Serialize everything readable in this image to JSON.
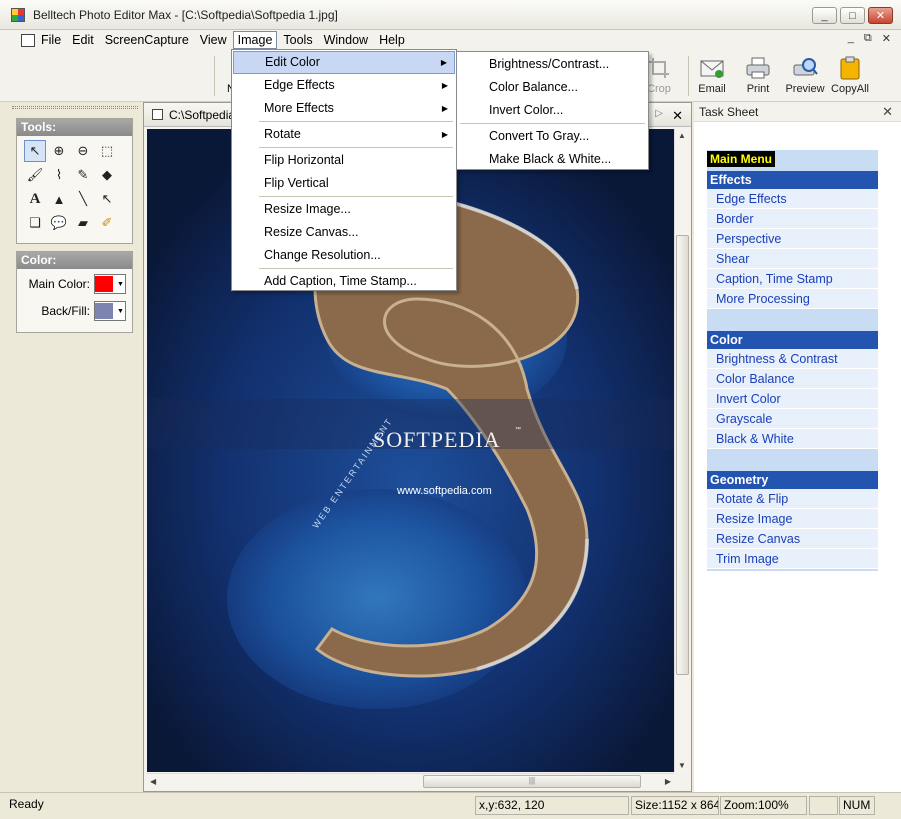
{
  "window": {
    "title": "Belltech Photo Editor Max - [C:\\Softpedia\\Softpedia 1.jpg]",
    "controls": [
      "_",
      "□",
      "✕"
    ]
  },
  "menubar": {
    "items": [
      "File",
      "Edit",
      "ScreenCapture",
      "View",
      "Image",
      "Tools",
      "Window",
      "Help"
    ],
    "active": "Image",
    "mdi_controls": [
      "_",
      "⧉",
      "✕"
    ]
  },
  "toolbar": {
    "partial_left": "N",
    "crop": "Crop",
    "email": "Email",
    "print": "Print",
    "preview": "Preview",
    "copyall": "CopyAll"
  },
  "image_menu": {
    "items": [
      {
        "label": "Edit Color",
        "submenu": true
      },
      {
        "label": "Edge Effects",
        "submenu": true
      },
      {
        "label": "More Effects",
        "submenu": true
      },
      {
        "label": "Rotate",
        "submenu": true
      },
      {
        "label": "Flip Horizontal"
      },
      {
        "label": "Flip Vertical"
      },
      {
        "label": "Resize Image..."
      },
      {
        "label": "Resize Canvas..."
      },
      {
        "label": "Change Resolution..."
      },
      {
        "label": "Add Caption, Time Stamp..."
      }
    ]
  },
  "edit_color_menu": {
    "items": [
      "Brightness/Contrast...",
      "Color Balance...",
      "Invert Color...",
      "Convert To Gray...",
      "Make Black & White..."
    ]
  },
  "tools_panel": {
    "title": "Tools:",
    "tools": [
      "↖",
      "⊕",
      "⊖",
      "⬚",
      "🖌",
      "⌇",
      "✎",
      "◆",
      "A",
      "▲",
      "╲",
      "↖",
      "❑",
      "💬",
      "▰",
      "✐"
    ]
  },
  "color_panel": {
    "title": "Color:",
    "main_label": "Main Color:",
    "back_label": "Back/Fill:",
    "main_color": "#ff0000",
    "back_color": "#7d84b0"
  },
  "document": {
    "title": "C:\\Softpedia",
    "watermark_brand": "SOFTPEDIA",
    "watermark_url": "www.softpedia.com",
    "watermark_side": "WEB ENTERTAINMENT",
    "watermark_tm": "™"
  },
  "task_sheet": {
    "title": "Task Sheet",
    "main_menu": "Main Menu",
    "sections": [
      {
        "head": "Effects",
        "links": [
          "Edge Effects",
          "Border",
          "Perspective",
          "Shear",
          "Caption, Time Stamp",
          "More Processing"
        ]
      },
      {
        "head": "Color",
        "links": [
          "Brightness & Contrast",
          "Color Balance",
          "Invert Color",
          "Grayscale",
          "Black & White"
        ]
      },
      {
        "head": "Geometry",
        "links": [
          "Rotate & Flip",
          "Resize Image",
          "Resize Canvas",
          "Trim Image"
        ]
      }
    ]
  },
  "statusbar": {
    "ready": "Ready",
    "coords": "x,y:632, 120",
    "size": "Size:1152 x 864",
    "zoom": "Zoom:100%",
    "num": "NUM"
  }
}
